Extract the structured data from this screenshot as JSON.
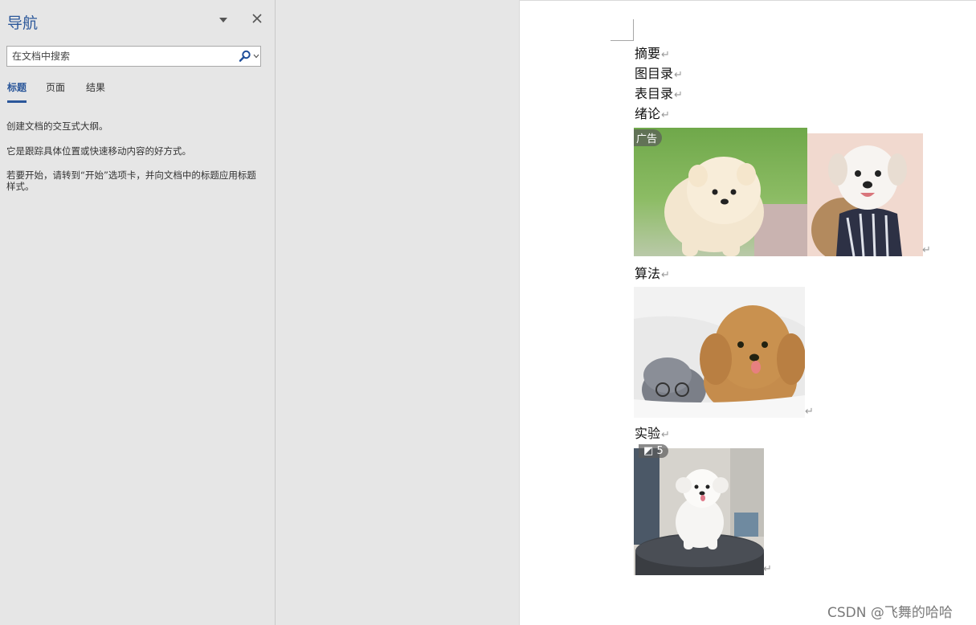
{
  "nav": {
    "title": "导航",
    "search_placeholder": "在文档中搜索",
    "tabs": [
      {
        "label": "标题",
        "active": true
      },
      {
        "label": "页面",
        "active": false
      },
      {
        "label": "结果",
        "active": false
      }
    ],
    "messages": [
      "创建文档的交互式大纲。",
      "它是跟踪具体位置或快速移动内容的好方式。",
      "若要开始，请转到“开始”选项卡，并向文档中的标题应用标题样式。"
    ]
  },
  "document": {
    "lines": [
      "摘要",
      "图目录",
      "表目录",
      "绪论",
      "算法",
      "实验"
    ],
    "paragraph_mark": "↵",
    "images": [
      {
        "name": "pomeranian",
        "badge": "广告"
      },
      {
        "name": "maltese",
        "badge": ""
      },
      {
        "name": "poodle-and-cat",
        "badge": ""
      },
      {
        "name": "white-poodle-on-table",
        "badge": "5"
      }
    ]
  },
  "watermark": "CSDN @飞舞的哈哈",
  "colors": {
    "accent": "#2b579a",
    "pane_bg": "#e6e6e6",
    "page_bg": "#ffffff"
  }
}
